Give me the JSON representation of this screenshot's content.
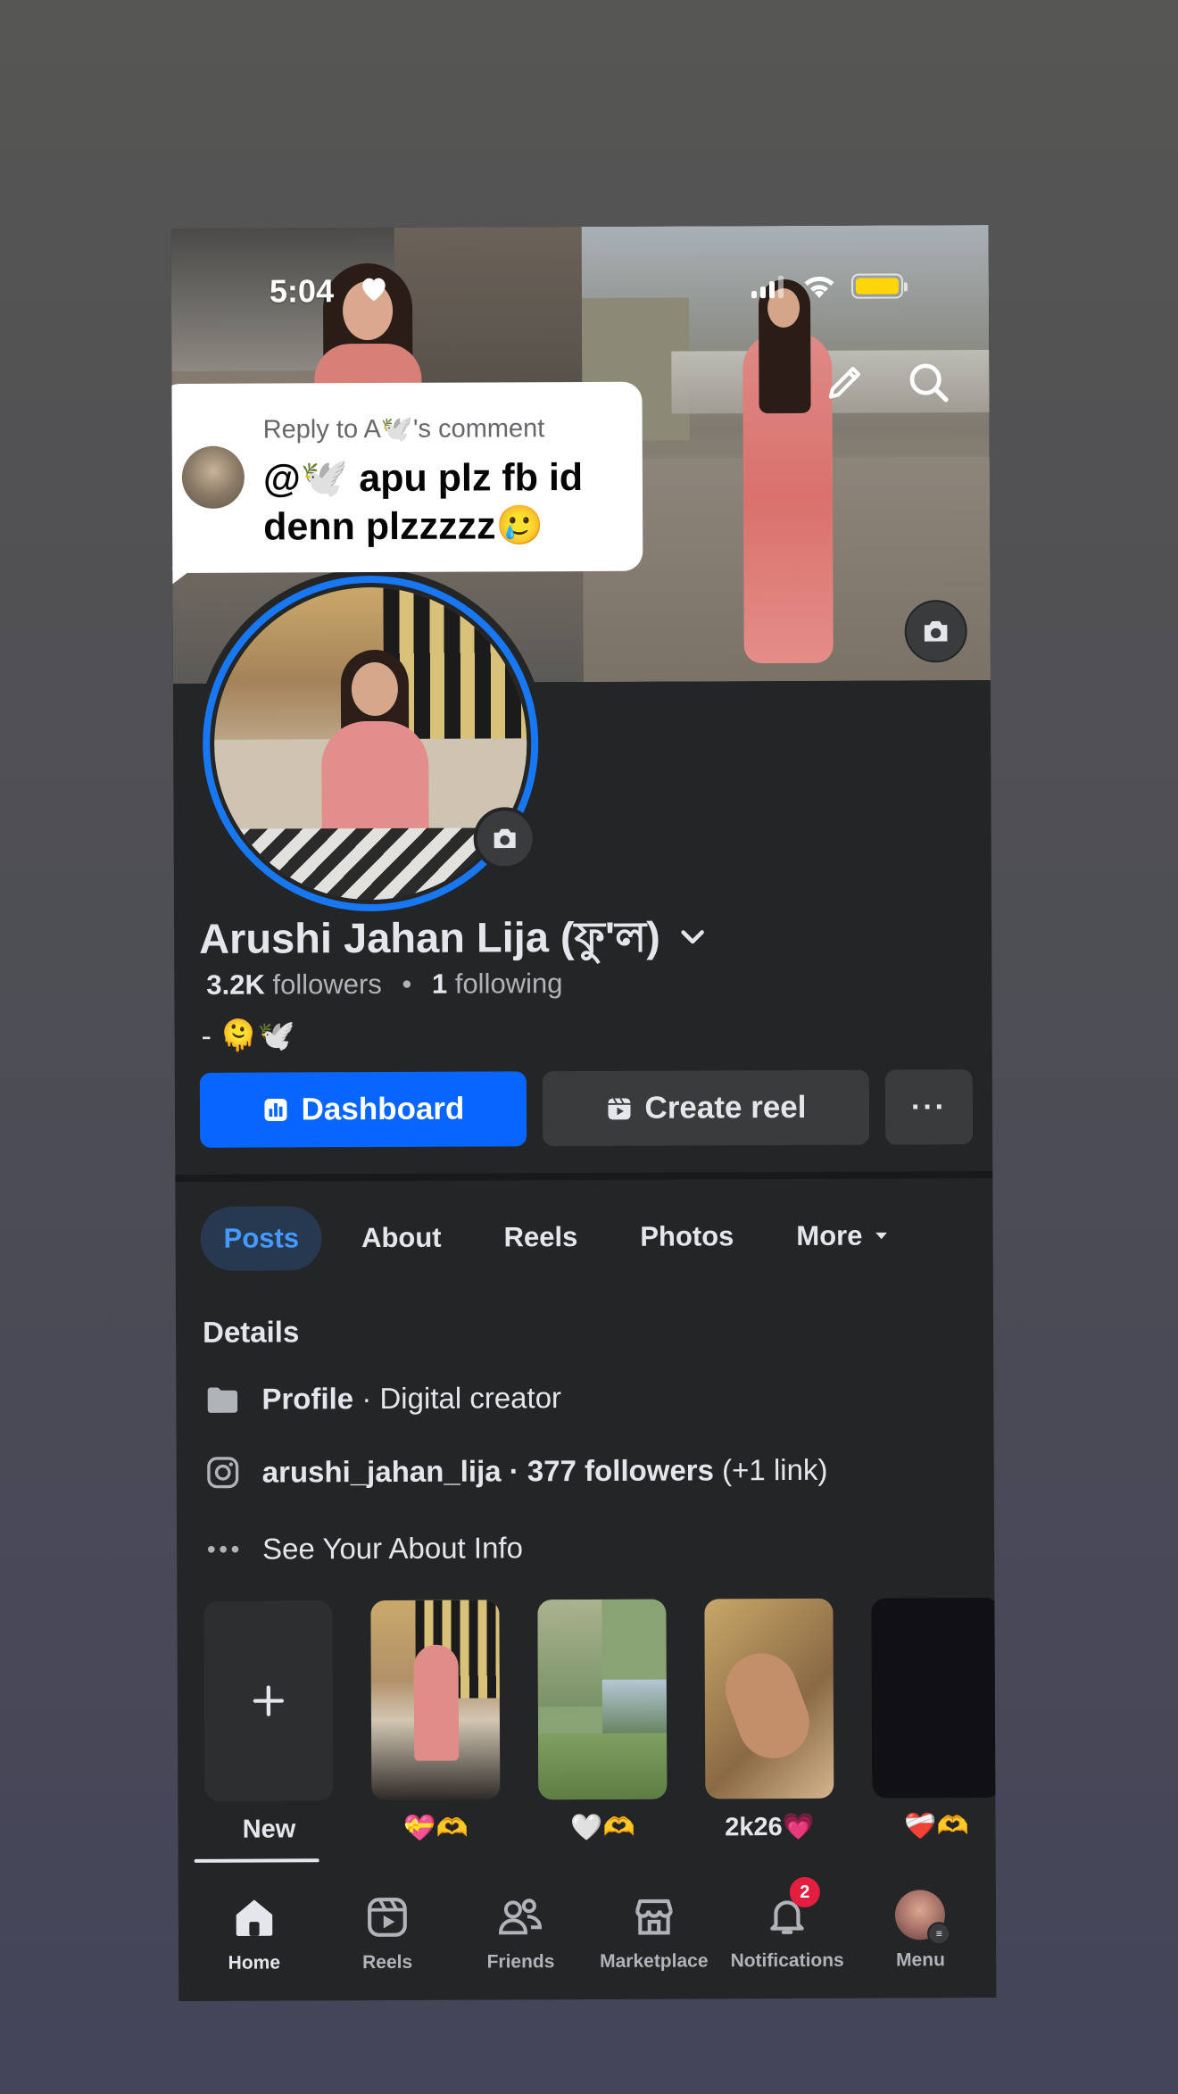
{
  "status_bar": {
    "time": "5:04"
  },
  "reply": {
    "label": "Reply to A🕊️'s comment",
    "text": "@🕊️ apu plz fb id denn plzzzzz🥲"
  },
  "profile": {
    "name": "Arushi Jahan Lija (ফু'ল)",
    "followers_count": "3.2K",
    "followers_label": "followers",
    "following_count": "1",
    "following_label": "following",
    "bio": "- 🫠🕊️"
  },
  "buttons": {
    "dashboard": "Dashboard",
    "create_reel": "Create reel",
    "more": "···"
  },
  "tabs": [
    {
      "label": "Posts",
      "active": true
    },
    {
      "label": "About"
    },
    {
      "label": "Reels"
    },
    {
      "label": "Photos"
    },
    {
      "label": "More"
    }
  ],
  "details": {
    "title": "Details",
    "profile_bold": "Profile",
    "profile_rest": " · Digital creator",
    "instagram_bold": "arushi_jahan_lija · 377 followers",
    "instagram_rest": " (+1 link)",
    "about_info": "See Your About Info"
  },
  "highlights": [
    {
      "label": "New"
    },
    {
      "label": "💝🫶"
    },
    {
      "label": "🤍🫶"
    },
    {
      "label": "2k26💗"
    },
    {
      "label": "❤️‍🩹🫶"
    }
  ],
  "bottom_nav": [
    {
      "label": "Home",
      "icon": "home-icon",
      "active": true
    },
    {
      "label": "Reels",
      "icon": "reels-icon"
    },
    {
      "label": "Friends",
      "icon": "friends-icon"
    },
    {
      "label": "Marketplace",
      "icon": "marketplace-icon"
    },
    {
      "label": "Notifications",
      "icon": "bell-icon",
      "badge": "2"
    },
    {
      "label": "Menu",
      "icon": "avatar"
    }
  ],
  "colors": {
    "primary": "#0866ff",
    "ring": "#1877f2",
    "active_tab_bg": "#263951",
    "active_tab_text": "#4599ff",
    "badge": "#e41e3f",
    "background": "#242526"
  }
}
